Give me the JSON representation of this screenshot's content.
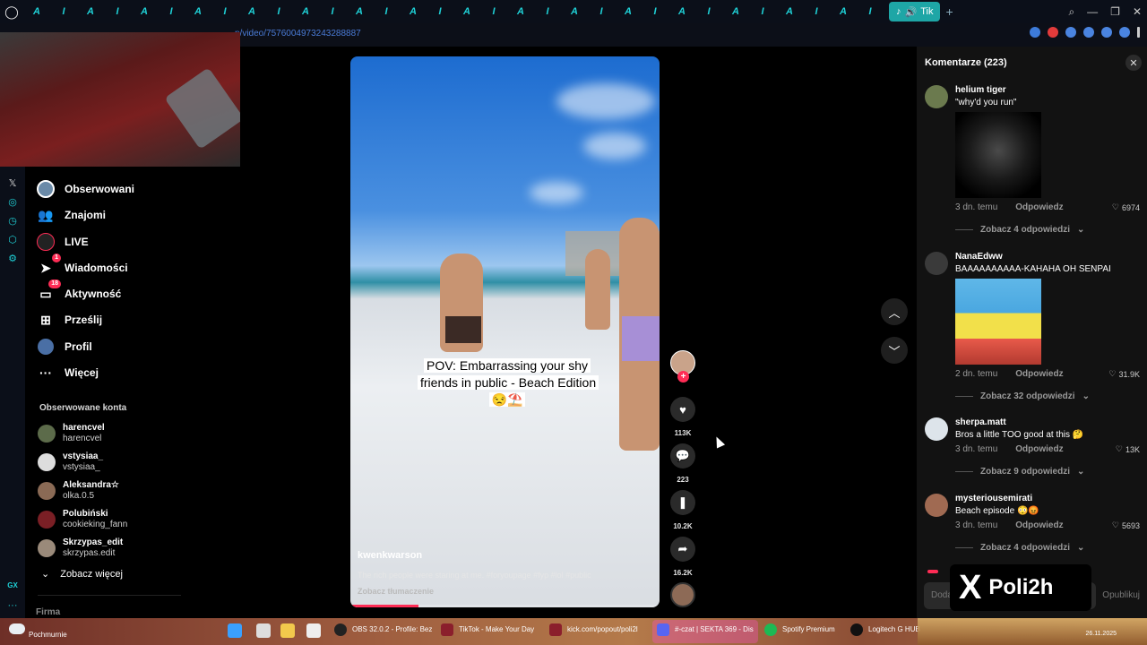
{
  "browser": {
    "url": "n/video/7576004973243288887",
    "active_tab_label": "Tik",
    "mini_tabs": [
      "A",
      "I",
      "A",
      "I",
      "A",
      "I",
      "A",
      "I",
      "A",
      "I",
      "A",
      "I",
      "A",
      "I",
      "A",
      "I",
      "A",
      "I",
      "A",
      "I",
      "A",
      "I",
      "A",
      "I",
      "A",
      "I",
      "A",
      "I",
      "A",
      "I",
      "A",
      "I"
    ]
  },
  "sidebar": {
    "items": [
      {
        "label": "Obserwowani",
        "icon": "following-avatar-icon"
      },
      {
        "label": "Znajomi",
        "icon": "friends-icon"
      },
      {
        "label": "LIVE",
        "icon": "live-icon"
      },
      {
        "label": "Wiadomości",
        "icon": "messages-icon",
        "badge": "1"
      },
      {
        "label": "Aktywność",
        "icon": "activity-icon",
        "badge": "18"
      },
      {
        "label": "Prześlij",
        "icon": "upload-icon"
      },
      {
        "label": "Profil",
        "icon": "profile-icon"
      },
      {
        "label": "Więcej",
        "icon": "more-icon"
      }
    ],
    "section_title": "Obserwowane konta",
    "accounts": [
      {
        "name": "harencvel",
        "handle": "harencvel"
      },
      {
        "name": "vstysiaa_",
        "handle": "vstysiaa_"
      },
      {
        "name": "Aleksandra☆",
        "handle": "olka.0.5"
      },
      {
        "name": "Polubiński",
        "handle": "cookieking_fann"
      },
      {
        "name": "Skrzypas_edit",
        "handle": "skrzypas.edit"
      }
    ],
    "see_more": "Zobacz więcej",
    "footer": "Firma"
  },
  "video": {
    "caption": "POV: Embarrassing your shy friends in public - Beach Edition 😒⛱️",
    "author": "kwenkwarson",
    "description": "The rich people were staring at me. #foryoupage #fyp #lol #public",
    "translate": "Zobacz tłumaczenie",
    "progress": 0.22
  },
  "actions": {
    "likes": "113K",
    "comments": "223",
    "saves": "10.2K",
    "shares": "16.2K",
    "follow": "+"
  },
  "comments_panel": {
    "title": "Komentarze (223)",
    "items": [
      {
        "user": "helium tiger",
        "text": "\"why'd you run\"",
        "time": "3 dn. temu",
        "reply": "Odpowiedz",
        "likes": "6974",
        "replies": "Zobacz 4 odpowiedzi"
      },
      {
        "user": "NanaEdww",
        "text": "BAAAAAAAAAA-KAHAHA OH SENPAI",
        "time": "2 dn. temu",
        "reply": "Odpowiedz",
        "likes": "31.9K",
        "replies": "Zobacz 32 odpowiedzi"
      },
      {
        "user": "sherpa.matt",
        "text": "Bros a little TOO good at this 🤔",
        "time": "3 dn. temu",
        "reply": "Odpowiedz",
        "likes": "13K",
        "replies": "Zobacz 9 odpowiedzi"
      },
      {
        "user": "mysteriousemirati",
        "text": "Beach episode 😳😡",
        "time": "3 dn. temu",
        "reply": "Odpowiedz",
        "likes": "5693",
        "replies": "Zobacz 4 odpowiedzi"
      }
    ],
    "input_placeholder": "Dodaj",
    "post_label": "Opublikuj"
  },
  "overlay": {
    "brand": "Poli2h"
  },
  "taskbar": {
    "weather": "Pochmurnie",
    "apps": [
      {
        "label": "OBS 32.0.2 - Profile: Bez"
      },
      {
        "label": "TikTok - Make Your Day"
      },
      {
        "label": "kick.com/popout/poli2l"
      },
      {
        "label": "#-czat | SEKTA 369 - Dis"
      },
      {
        "label": "Spotify Premium"
      },
      {
        "label": "Logitech G HUB"
      }
    ],
    "time": "",
    "date": "26.11.2025"
  },
  "colors": {
    "accent": "#fe2c55",
    "opera_gx": "#1fd0d6"
  }
}
